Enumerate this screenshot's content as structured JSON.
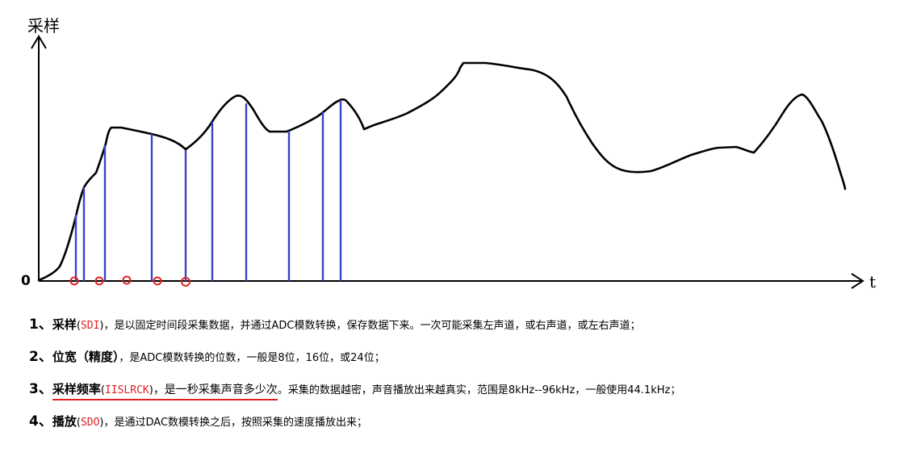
{
  "diagram": {
    "y_axis_label": "采样",
    "x_axis_label": "t",
    "origin_label": "0",
    "colors": {
      "curve": "#000000",
      "sample_lines": "#3a44c8",
      "markers": "#e02020",
      "axes": "#000000"
    }
  },
  "notes": [
    {
      "num": "1、",
      "term": "采样",
      "paren_open": "(",
      "abbr": "SDI",
      "paren_close": ")",
      "text": "，是以固定时间段采集数据，并通过ADC模数转换，保存数据下来。一次可能采集左声道，或右声道，或左右声道；"
    },
    {
      "num": "2、",
      "term": "位宽（精度）",
      "text": "，是ADC模数转换的位数，一般是8位，16位，或24位；"
    },
    {
      "num": "3、",
      "term": "采样频率",
      "paren_open": "(",
      "abbr": "IISLRCK",
      "paren_close": ")",
      "emph": "，是一秒采集声音多少次",
      "text": "。采集的数据越密，声音播放出来越真实，范围是8kHz--96kHz，一般使用44.1kHz；"
    },
    {
      "num": "4、",
      "term": "播放",
      "paren_open": "(",
      "abbr": "SDO",
      "paren_close": ")",
      "text": "，是通过DAC数模转换之后，按照采集的速度播放出来；"
    }
  ]
}
